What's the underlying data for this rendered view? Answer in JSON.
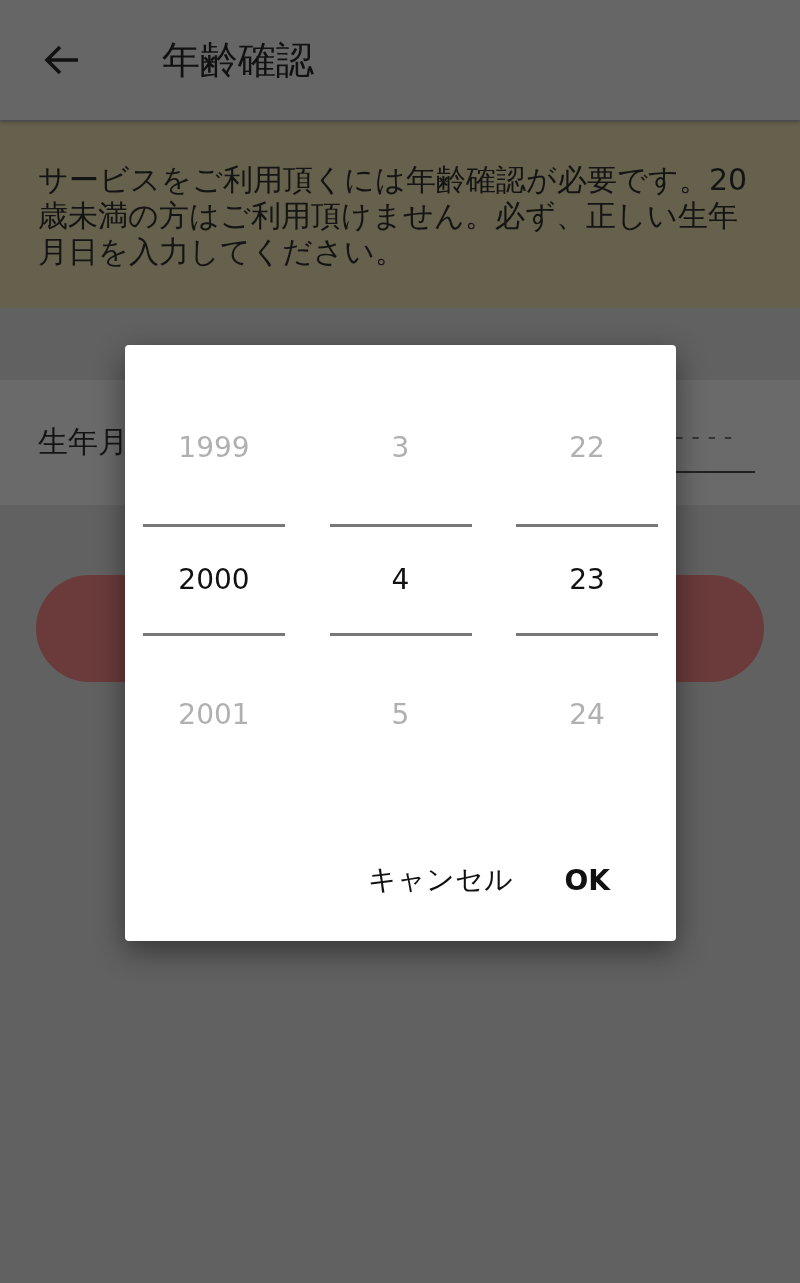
{
  "header": {
    "title": "年齢確認"
  },
  "notice": {
    "text": "サービスをご利用頂くには年齢確認が必要です。20歳未満の方はご利用頂けません。必ず、正しい生年月日を入力してください。"
  },
  "form": {
    "label": "生年月",
    "date_field": {
      "value": "- - - -"
    }
  },
  "dialog": {
    "columns": [
      {
        "items": [
          {
            "label": "1999",
            "selected": false
          },
          {
            "label": "2000",
            "selected": true
          },
          {
            "label": "2001",
            "selected": false
          }
        ]
      },
      {
        "items": [
          {
            "label": "3",
            "selected": false
          },
          {
            "label": "4",
            "selected": true
          },
          {
            "label": "5",
            "selected": false
          }
        ]
      },
      {
        "items": [
          {
            "label": "22",
            "selected": false
          },
          {
            "label": "23",
            "selected": true
          },
          {
            "label": "24",
            "selected": false
          }
        ]
      }
    ],
    "buttons": [
      {
        "label": "キャンセル"
      },
      {
        "label": "OK"
      }
    ]
  }
}
